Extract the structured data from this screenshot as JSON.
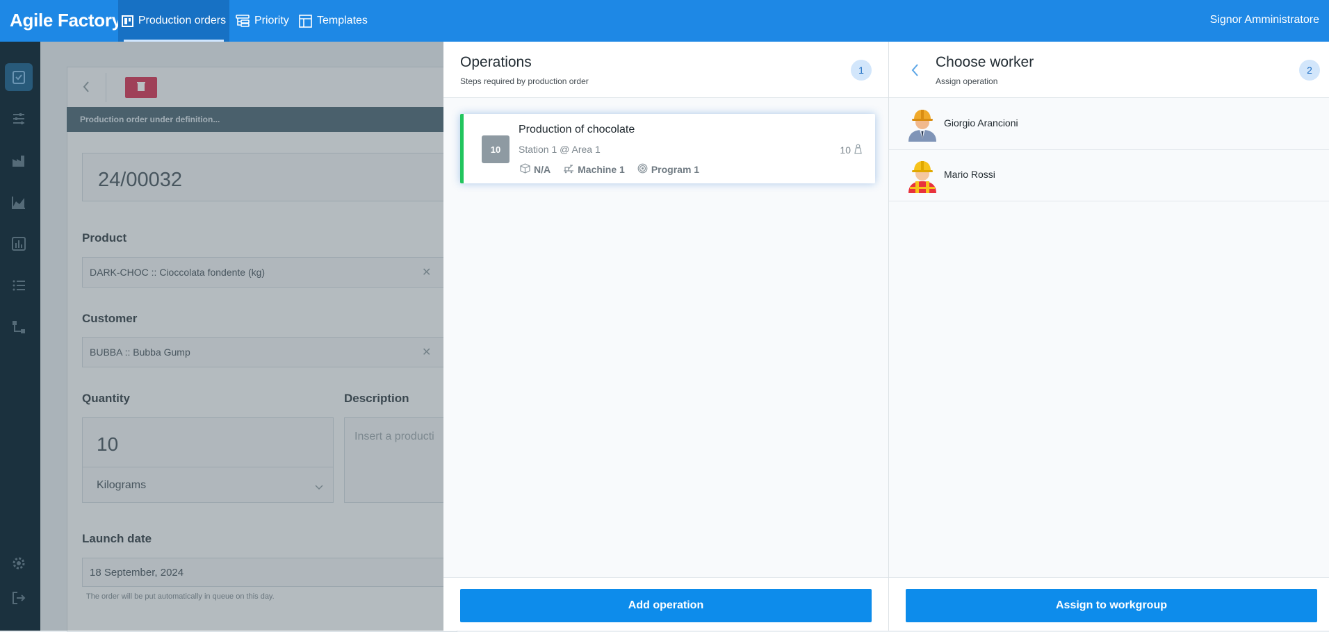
{
  "app": {
    "brand": "Agile Factory",
    "nav": [
      {
        "label": "Production orders",
        "icon": "board-icon",
        "active": true
      },
      {
        "label": "Priority",
        "icon": "list-tree-icon",
        "active": false
      },
      {
        "label": "Templates",
        "icon": "template-icon",
        "active": false
      }
    ],
    "user": "Signor Amministratore"
  },
  "background_form": {
    "status": "Production order under definition...",
    "order_number": "24/00032",
    "product_label": "Product",
    "product_value": "DARK-CHOC :: Cioccolata fondente (kg)",
    "customer_label": "Customer",
    "customer_value": "BUBBA :: Bubba Gump",
    "quantity_label": "Quantity",
    "quantity_value": "10",
    "unit_value": "Kilograms",
    "description_label": "Description",
    "description_placeholder": "Insert a producti",
    "launch_label": "Launch date",
    "launch_value": "18 September, 2024",
    "launch_hint": "The order will be put automatically in queue on this day."
  },
  "operations_panel": {
    "title": "Operations",
    "subtitle": "Steps required by production order",
    "step": "1",
    "operation": {
      "number": "10",
      "title": "Production of chocolate",
      "station": "Station 1 @ Area 1",
      "quantity": "10",
      "tags": [
        {
          "label": "N/A",
          "icon": "box-icon"
        },
        {
          "label": "Machine 1",
          "icon": "machine-icon"
        },
        {
          "label": "Program 1",
          "icon": "program-icon"
        }
      ]
    },
    "add_button": "Add operation"
  },
  "worker_panel": {
    "title": "Choose worker",
    "subtitle": "Assign operation",
    "step": "2",
    "workers": [
      {
        "name": "Giorgio Arancioni",
        "avatar": "worker-avatar-icon"
      },
      {
        "name": "Mario Rossi",
        "avatar": "worker-avatar-icon"
      }
    ],
    "assign_button": "Assign to workgroup"
  },
  "colors": {
    "topbar": "#1e88e5",
    "sidebar": "#1c3442",
    "primary_button": "#0d8ceb",
    "op_accent": "#22c55e",
    "badge_bg": "#d2e6fb"
  }
}
